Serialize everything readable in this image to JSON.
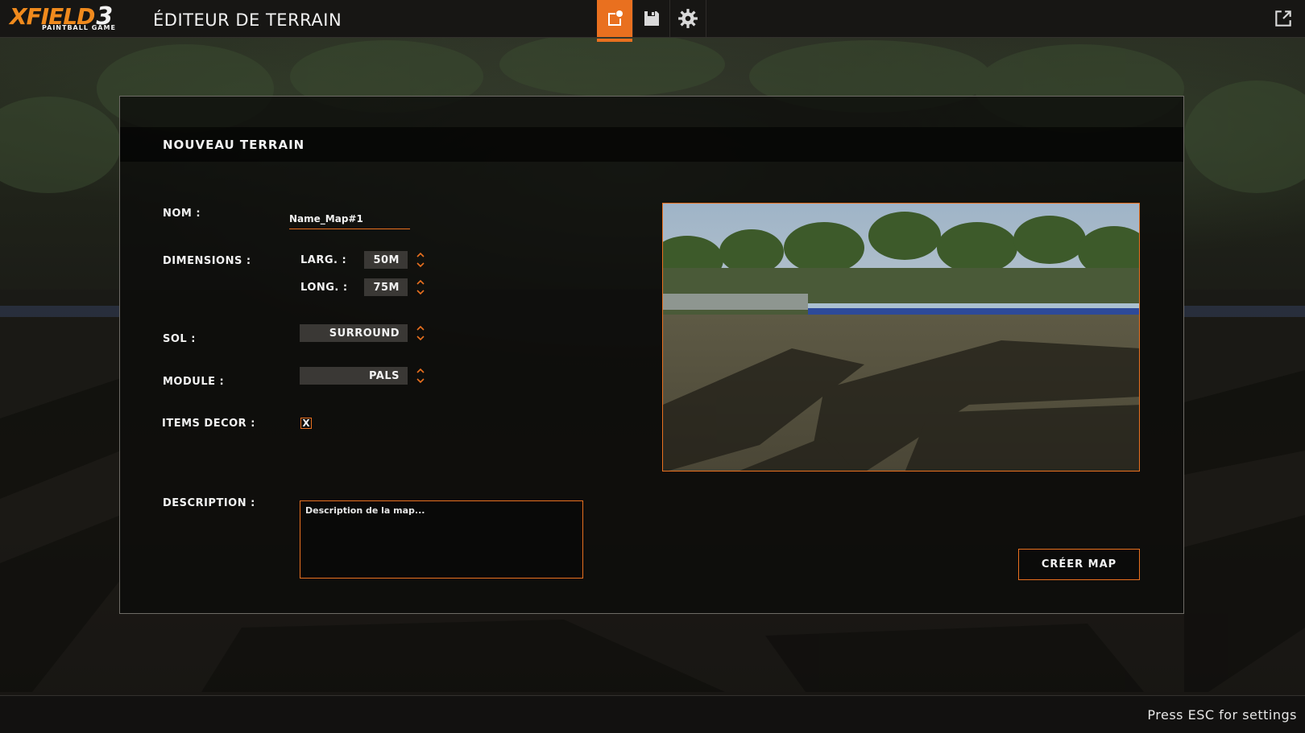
{
  "topbar": {
    "logo_main": "XFIELD",
    "logo_number": "3",
    "logo_sub": "PAINTBALL GAME",
    "title": "ÉDITEUR DE TERRAIN",
    "accent_color": "#e9701f",
    "buttons": [
      {
        "icon": "new-map-icon",
        "active": true
      },
      {
        "icon": "save-icon",
        "active": false
      },
      {
        "icon": "gear-icon",
        "active": false
      }
    ],
    "external_icon": "external-link-icon"
  },
  "panel": {
    "title": "NOUVEAU TERRAIN",
    "fields": {
      "name_label": "NOM :",
      "name_value": "Name_Map#1",
      "dimensions_label": "DIMENSIONS :",
      "width_label": "LARG. :",
      "width_value": "50M",
      "length_label": "LONG. :",
      "length_value": "75M",
      "ground_label": "SOL :",
      "ground_value": "SURROUND",
      "module_label": "MODULE  :",
      "module_value": "PALS",
      "decor_label": "ITEMS DECOR :",
      "decor_checked": true,
      "decor_mark": "X",
      "description_label": "DESCRIPTION :",
      "description_placeholder": "Description de la map..."
    },
    "create_button": "CRÉER MAP"
  },
  "footer": {
    "hint": "Press ESC for settings"
  }
}
